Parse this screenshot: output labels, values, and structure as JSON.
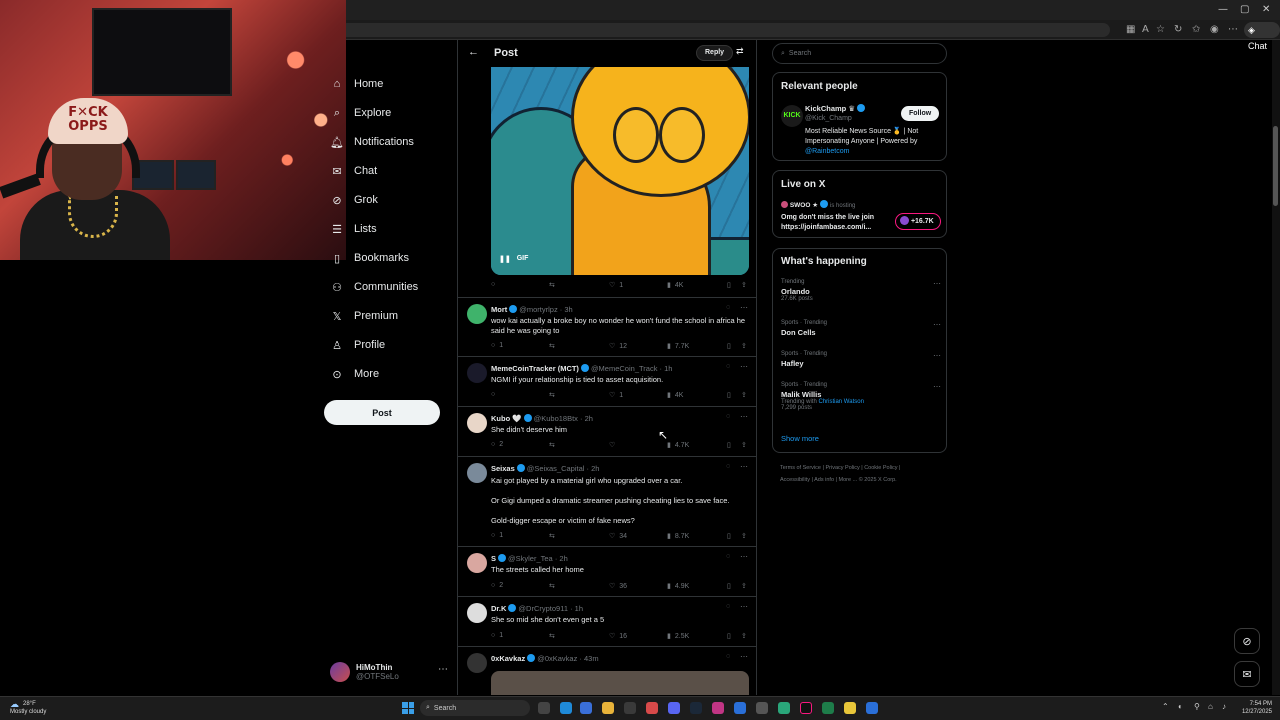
{
  "browser": {
    "window_controls": [
      "—",
      "▢",
      "✕"
    ],
    "chat_label": "Chat"
  },
  "nav": {
    "items": [
      {
        "label": "Home",
        "icon": "home-icon"
      },
      {
        "label": "Explore",
        "icon": "search-icon"
      },
      {
        "label": "Notifications",
        "icon": "bell-icon"
      },
      {
        "label": "Chat",
        "icon": "chat-icon"
      },
      {
        "label": "Grok",
        "icon": "grok-icon"
      },
      {
        "label": "Lists",
        "icon": "list-icon"
      },
      {
        "label": "Bookmarks",
        "icon": "bookmark-icon"
      },
      {
        "label": "Communities",
        "icon": "communities-icon"
      },
      {
        "label": "Premium",
        "icon": "x-logo-icon"
      },
      {
        "label": "Profile",
        "icon": "person-icon"
      },
      {
        "label": "More",
        "icon": "more-circle-icon"
      }
    ],
    "post_label": "Post",
    "account": {
      "name": "HiMoThin",
      "handle": "@OTFSeLo"
    }
  },
  "column": {
    "title": "Post",
    "reply_label": "Reply",
    "gif_label": "GIF",
    "gif_actions": {
      "replies": "",
      "reposts": "",
      "likes": "1",
      "views": "4K"
    }
  },
  "tweets": [
    {
      "name": "Mort",
      "badges": "",
      "handle": "@mortyrlpz",
      "time": "3h",
      "text": "wow kai actually a broke boy no wonder he won't fund the school in africa he said he was going to",
      "replies": "1",
      "reposts": "",
      "likes": "12",
      "views": "7.7K",
      "avatar_color": "#3fb36b"
    },
    {
      "name": "MemeCoinTracker (MCT)",
      "badges": "",
      "handle": "@MemeCoin_Track",
      "time": "1h",
      "text": "NGMI if your relationship is tied to asset acquisition.",
      "replies": "",
      "reposts": "",
      "likes": "1",
      "views": "4K",
      "avatar_color": "#1a1a2a"
    },
    {
      "name": "Kubo",
      "badges": "🤍",
      "handle": "@Kubo18Btx",
      "time": "2h",
      "text": "She didn't deserve him",
      "replies": "2",
      "reposts": "",
      "likes": "",
      "views": "4.7K",
      "avatar_color": "#e8d6c8"
    },
    {
      "name": "Seixas",
      "badges": "",
      "handle": "@Seixas_Capital",
      "time": "2h",
      "text": "Kai got played by a material girl who upgraded over a car.",
      "text2": "Or Gigi dumped a dramatic streamer pushing cheating lies to save face.",
      "text3": "Gold-digger escape or victim of fake news?",
      "replies": "1",
      "reposts": "",
      "likes": "34",
      "views": "8.7K",
      "avatar_color": "#7a8a9a"
    },
    {
      "name": "S",
      "badges": "",
      "handle": "@Skyler_Tea",
      "time": "2h",
      "text": "The streets called her home",
      "replies": "2",
      "reposts": "",
      "likes": "36",
      "views": "4.9K",
      "avatar_color": "#d9a7a0"
    },
    {
      "name": "Dr.K",
      "badges": "",
      "handle": "@DrCrypto911",
      "time": "1h",
      "text": "She so mid she don't even get a 5",
      "replies": "1",
      "reposts": "",
      "likes": "16",
      "views": "2.5K",
      "avatar_color": "#ddd"
    },
    {
      "name": "0xKavkaz",
      "badges": "",
      "handle": "@0xKavkaz",
      "time": "43m",
      "text": "",
      "avatar_color": "#333"
    }
  ],
  "right": {
    "search_placeholder": "Search",
    "relevant": {
      "title": "Relevant people",
      "name": "KickChamp",
      "handle": "@Kick_Champ",
      "follow_label": "Follow",
      "bio": "Most Reliable News Source 🥇 | Not Impersonating Anyone | Powered by",
      "bio_link": "@Rainbetcom"
    },
    "live": {
      "title": "Live on X",
      "host": "SWOO",
      "host_suffix": "is hosting",
      "text": "Omg don't miss the live join https://joinfambase.com/i...",
      "count": "+16.7K"
    },
    "happening": {
      "title": "What's happening",
      "trends": [
        {
          "meta": "Trending",
          "name": "Orlando",
          "posts": "27.6K posts"
        },
        {
          "meta": "Sports · Trending",
          "name": "Don Cells",
          "posts": ""
        },
        {
          "meta": "Sports · Trending",
          "name": "Hafley",
          "posts": ""
        },
        {
          "meta": "Sports · Trending",
          "name": "Malik Willis",
          "extra": "Trending with",
          "extra_link": "Christian Watson",
          "posts": "7,299 posts"
        }
      ],
      "show_more": "Show more"
    },
    "footer": [
      "Terms of Service",
      "Privacy Policy",
      "Cookie Policy",
      "Accessibility",
      "Ads info",
      "More ...",
      "© 2025 X Corp."
    ]
  },
  "taskbar": {
    "weather_temp": "28°F",
    "weather_desc": "Mostly cloudy",
    "search_label": "Search",
    "time": "7:54 PM",
    "date": "12/27/2025"
  },
  "colors": {
    "accent": "#1d9bf0",
    "background": "#000000",
    "border": "#2f3336"
  }
}
